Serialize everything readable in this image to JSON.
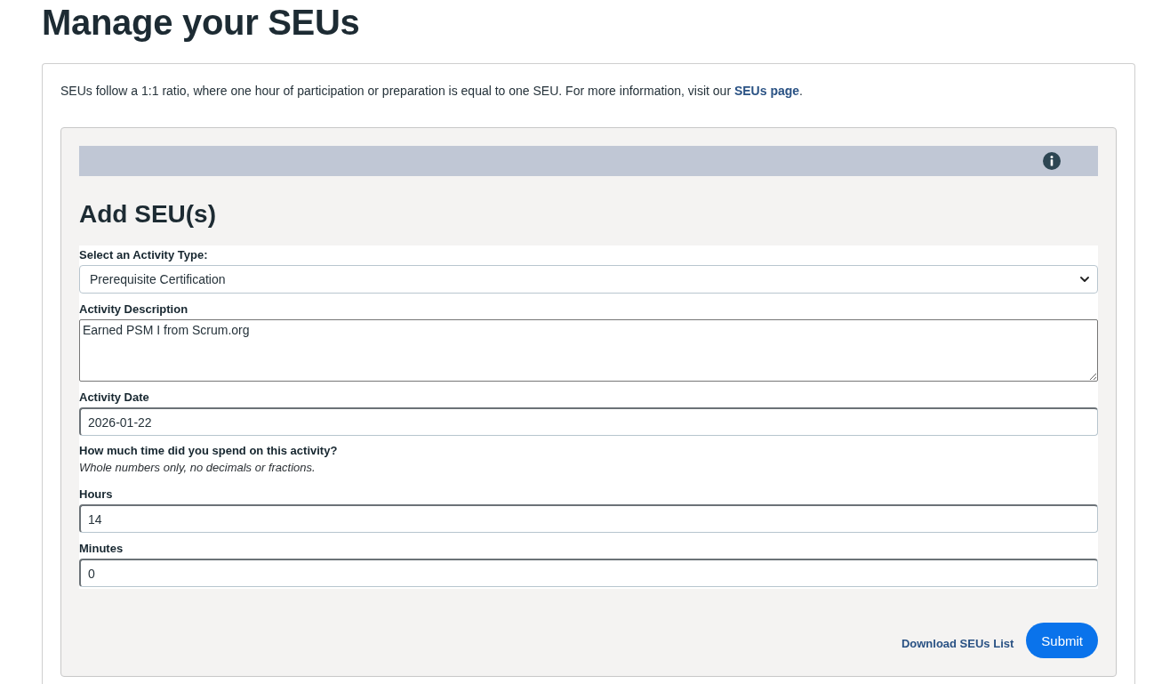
{
  "page": {
    "title": "Manage your SEUs"
  },
  "intro": {
    "text_before": "SEUs follow a 1:1 ratio, where one hour of participation or preparation is equal to one SEU. For more information, visit our ",
    "link": "SEUs page",
    "text_after": "."
  },
  "form": {
    "title": "Add SEU(s)",
    "fields": [
      {
        "kind": "select",
        "label": "Select an Activity Type:",
        "value": "Prerequisite Certification"
      },
      {
        "kind": "textarea",
        "label": "Activity Description",
        "value": "Earned PSM I from Scrum.org"
      },
      {
        "kind": "input",
        "label": "Activity Date",
        "value": "2026-01-22"
      },
      {
        "kind": "note",
        "label": "How much time did you spend on this activity?",
        "hint": "Whole numbers only, no decimals or fractions."
      },
      {
        "kind": "input",
        "label": "Hours",
        "value": "14"
      },
      {
        "kind": "input",
        "label": "Minutes",
        "value": "0"
      }
    ],
    "actions": {
      "link": "Download SEUs List",
      "submit": "Submit"
    }
  }
}
